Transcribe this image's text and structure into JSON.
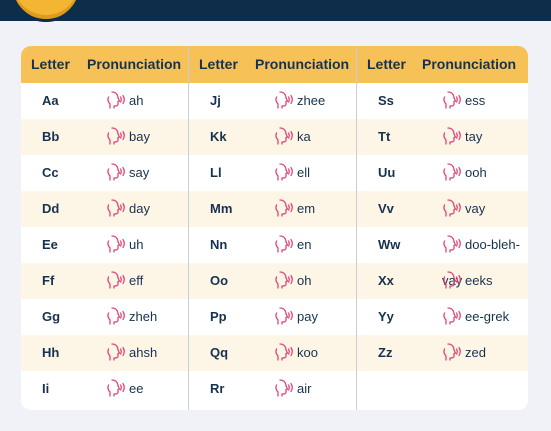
{
  "header": {
    "letter_label": "Letter",
    "pronunciation_label": "Pronunciation"
  },
  "icon": {
    "name": "speaking-head-icon",
    "color": "#e0457b"
  },
  "colors": {
    "header_bg": "#f6c156",
    "alt_row_bg": "#fdf5e6",
    "text": "#17324f",
    "top_bar": "#0d2d4a"
  },
  "columns": [
    {
      "rows": [
        {
          "letter": "Aa",
          "pronunciation": "ah"
        },
        {
          "letter": "Bb",
          "pronunciation": "bay"
        },
        {
          "letter": "Cc",
          "pronunciation": "say"
        },
        {
          "letter": "Dd",
          "pronunciation": "day"
        },
        {
          "letter": "Ee",
          "pronunciation": "uh"
        },
        {
          "letter": "Ff",
          "pronunciation": "eff"
        },
        {
          "letter": "Gg",
          "pronunciation": "zheh"
        },
        {
          "letter": "Hh",
          "pronunciation": "ahsh"
        },
        {
          "letter": "Ii",
          "pronunciation": "ee"
        }
      ]
    },
    {
      "rows": [
        {
          "letter": "Jj",
          "pronunciation": "zhee"
        },
        {
          "letter": "Kk",
          "pronunciation": "ka"
        },
        {
          "letter": "Ll",
          "pronunciation": "ell"
        },
        {
          "letter": "Mm",
          "pronunciation": "em"
        },
        {
          "letter": "Nn",
          "pronunciation": "en"
        },
        {
          "letter": "Oo",
          "pronunciation": "oh"
        },
        {
          "letter": "Pp",
          "pronunciation": "pay"
        },
        {
          "letter": "Qq",
          "pronunciation": "koo"
        },
        {
          "letter": "Rr",
          "pronunciation": "air"
        }
      ]
    },
    {
      "rows": [
        {
          "letter": "Ss",
          "pronunciation": "ess"
        },
        {
          "letter": "Tt",
          "pronunciation": "tay"
        },
        {
          "letter": "Uu",
          "pronunciation": "ooh"
        },
        {
          "letter": "Vv",
          "pronunciation": "vay"
        },
        {
          "letter": "Ww",
          "pronunciation": "doo-bleh-vay"
        },
        {
          "letter": "Xx",
          "pronunciation": "eeks"
        },
        {
          "letter": "Yy",
          "pronunciation": "ee-grek"
        },
        {
          "letter": "Zz",
          "pronunciation": "zed"
        }
      ]
    }
  ]
}
